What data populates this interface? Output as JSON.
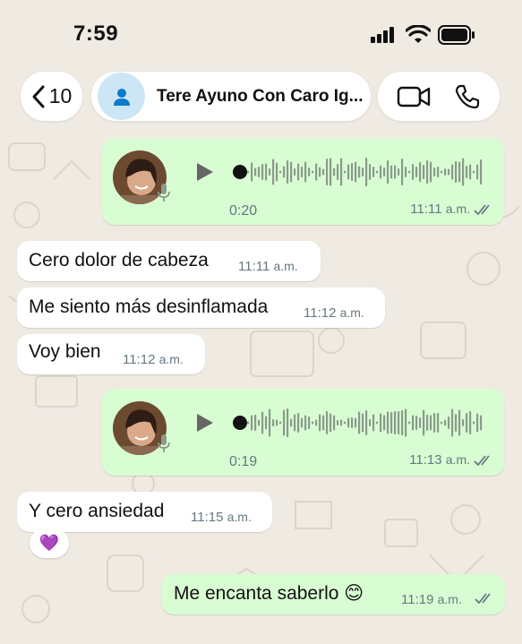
{
  "status_bar": {
    "time": "7:59"
  },
  "header": {
    "back_count": "10",
    "contact_name": "Tere Ayuno Con Caro Ig...",
    "icons": [
      "chevron-left-icon",
      "person-icon",
      "video-call-icon",
      "phone-icon"
    ]
  },
  "messages": [
    {
      "type": "voice",
      "direction": "outgoing",
      "duration": "0:20",
      "time": "11:11",
      "ampm": "a.m.",
      "status": "read"
    },
    {
      "type": "text",
      "direction": "incoming",
      "text": "Cero dolor de cabeza",
      "time": "11:11",
      "ampm": "a.m."
    },
    {
      "type": "text",
      "direction": "incoming",
      "text": "Me siento más desinflamada",
      "time": "11:12",
      "ampm": "a.m."
    },
    {
      "type": "text",
      "direction": "incoming",
      "text": "Voy bien",
      "time": "11:12",
      "ampm": "a.m."
    },
    {
      "type": "voice",
      "direction": "outgoing",
      "duration": "0:19",
      "time": "11:13",
      "ampm": "a.m.",
      "status": "read"
    },
    {
      "type": "text",
      "direction": "incoming",
      "text": "Y cero ansiedad",
      "time": "11:15",
      "ampm": "a.m.",
      "reaction": "💜"
    },
    {
      "type": "text",
      "direction": "outgoing",
      "text": "Me encanta saberlo 😊",
      "time": "11:19",
      "ampm": "a.m.",
      "status": "read"
    }
  ],
  "colors": {
    "outgoing_bubble": "#d9fdd3",
    "incoming_bubble": "#ffffff",
    "background": "#efeae2",
    "avatar_bg": "#cde6f6",
    "accent_blue": "#0a7cc9",
    "meta_gray": "#667781"
  }
}
